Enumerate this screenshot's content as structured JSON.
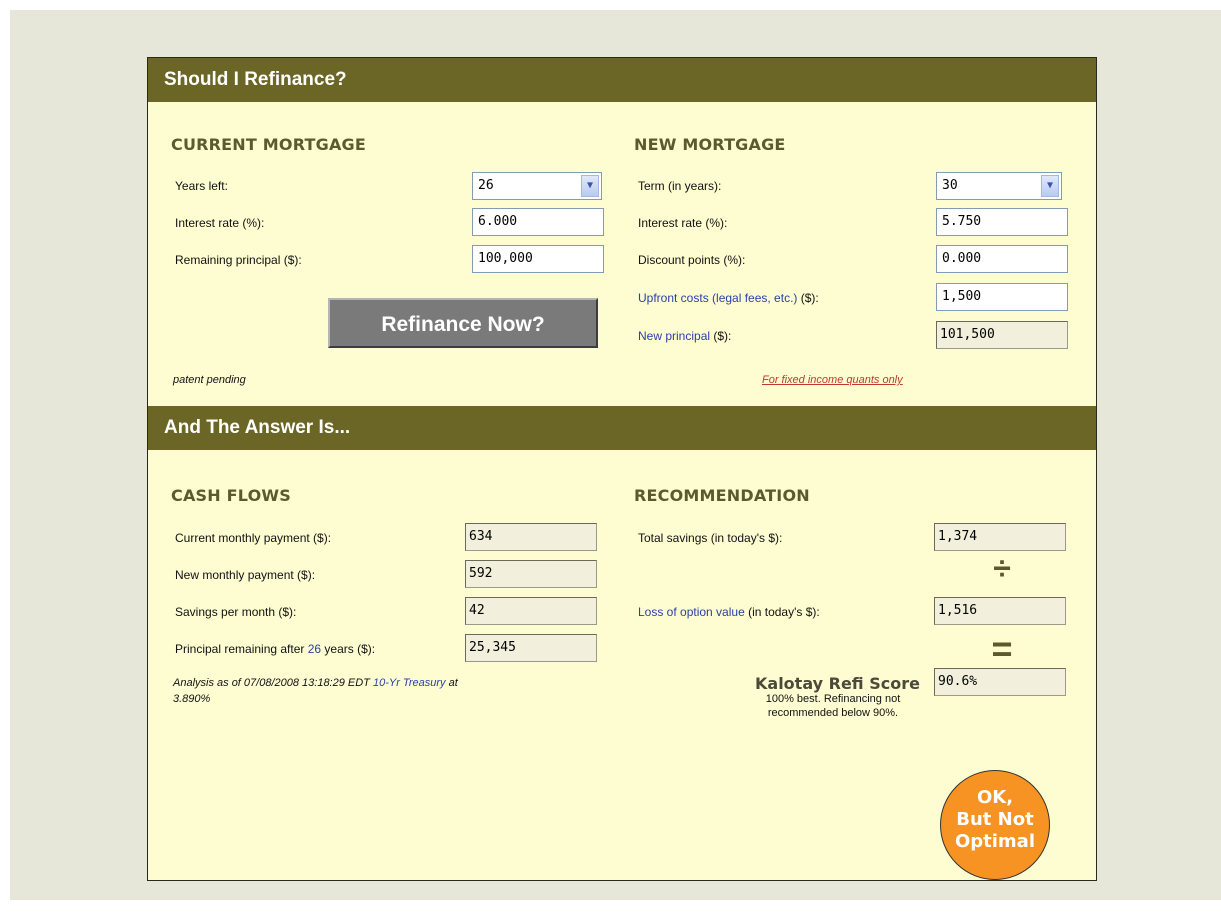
{
  "header": {
    "title": "Should I Refinance?",
    "answer_title": "And The Answer Is..."
  },
  "current": {
    "title": "CURRENT MORTGAGE",
    "years_left_label": "Years left:",
    "years_left_value": "26",
    "rate_label": "Interest rate (%):",
    "rate_value": "6.000",
    "principal_label": "Remaining principal ($):",
    "principal_value": "100,000",
    "refinance_button": "Refinance Now?",
    "patent": "patent pending"
  },
  "new": {
    "title": "NEW MORTGAGE",
    "term_label": "Term (in years):",
    "term_value": "30",
    "rate_label": "Interest rate (%):",
    "rate_value": "5.750",
    "points_label": "Discount points (%):",
    "points_value": "0.000",
    "upfront_link": "Upfront costs (legal fees, etc.)",
    "upfront_suffix": " ($):",
    "upfront_value": "1,500",
    "principal_link": "New principal",
    "principal_suffix": " ($):",
    "principal_value": "101,500",
    "quants_link": "For fixed income quants only"
  },
  "cashflows": {
    "title": "CASH FLOWS",
    "current_payment_label": "Current monthly payment ($):",
    "current_payment_value": "634",
    "new_payment_label": "New monthly payment ($):",
    "new_payment_value": "592",
    "savings_label": "Savings per month ($):",
    "savings_value": "42",
    "remaining_prefix": "Principal remaining after ",
    "remaining_years": "26",
    "remaining_suffix": " years ($):",
    "remaining_value": "25,345",
    "analysis_prefix": "Analysis as of 07/08/2008 13:18:29 EDT ",
    "analysis_link": "10-Yr Treasury",
    "analysis_suffix": " at",
    "analysis_rate": "3.890%"
  },
  "recommendation": {
    "title": "RECOMMENDATION",
    "total_savings_label": "Total savings (in today's $):",
    "total_savings_value": "1,374",
    "divide_symbol": "÷",
    "loss_link": "Loss of option value",
    "loss_suffix": " (in today's $):",
    "loss_value": "1,516",
    "equals_symbol": "=",
    "score_label": "Kalotay Refi Score",
    "score_value": "90.6%",
    "score_note_1": "100% best. Refinancing not",
    "score_note_2": "recommended below 90%.",
    "badge_line1": "OK,",
    "badge_line2": "But Not",
    "badge_line3": "Optimal"
  },
  "colors": {
    "header_bg": "#6b6526",
    "panel_bg": "#fefdd2",
    "outer_bg": "#e6e7d9",
    "link": "#2a3fa8",
    "badge": "#f69323",
    "quants_link": "#c0392b"
  }
}
